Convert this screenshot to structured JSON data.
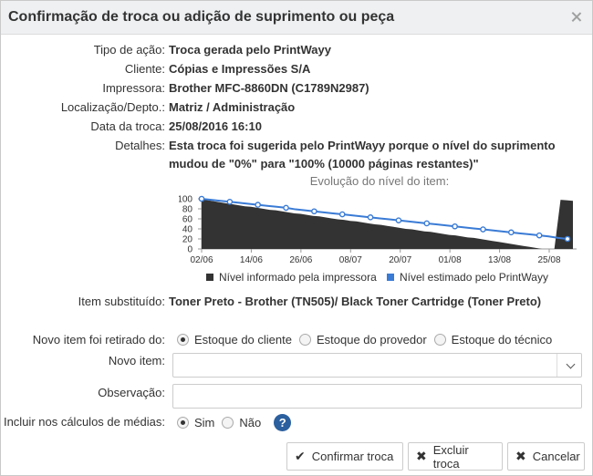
{
  "dialog": {
    "title": "Confirmação de troca ou adição de suprimento ou peça"
  },
  "details": [
    {
      "label": "Tipo de ação:",
      "value": "Troca gerada pelo PrintWayy"
    },
    {
      "label": "Cliente:",
      "value": "Cópias e Impressões S/A"
    },
    {
      "label": "Impressora:",
      "value": "Brother MFC-8860DN (C1789N2987)"
    },
    {
      "label": "Localização/Depto.:",
      "value": "Matriz / Administração"
    },
    {
      "label": "Data da troca:",
      "value": "25/08/2016 16:10"
    },
    {
      "label": "Detalhes:",
      "value": "Esta troca foi sugerida pelo PrintWayy porque o nível do suprimento mudou de \"0%\" para \"100% (10000 páginas restantes)\""
    }
  ],
  "chart_data": {
    "type": "area",
    "title": "Evolução do nível do item:",
    "xlabel": "",
    "ylabel": "",
    "x_ticks": [
      "02/06",
      "14/06",
      "26/06",
      "08/07",
      "20/07",
      "01/08",
      "13/08",
      "25/08"
    ],
    "y_ticks": [
      0,
      20,
      40,
      60,
      80,
      100
    ],
    "ylim": [
      0,
      100
    ],
    "grid": false,
    "legend_position": "bottom",
    "series": [
      {
        "name": "Nível informado pela impressora",
        "type": "area",
        "color": "#333333",
        "values": [
          99,
          97,
          95,
          93,
          91,
          89,
          87,
          85,
          84,
          82,
          80,
          78,
          77,
          75,
          73,
          71,
          70,
          68,
          66,
          65,
          63,
          61,
          59,
          58,
          56,
          55,
          53,
          51,
          49,
          48,
          46,
          44,
          42,
          40,
          39,
          37,
          35,
          34,
          32,
          30,
          28,
          27,
          25,
          23,
          22,
          20,
          18,
          16,
          14,
          12,
          10,
          8,
          6,
          4,
          2,
          0,
          0,
          0,
          98,
          97,
          96
        ]
      },
      {
        "name": "Nível estimado pelo PrintWayy",
        "type": "line",
        "color": "#3a7bd5",
        "values": [
          100,
          98,
          96,
          94,
          92,
          90,
          88,
          86,
          84,
          82,
          79,
          77,
          75,
          73,
          71,
          69,
          67,
          65,
          63,
          61,
          59,
          57,
          55,
          53,
          51,
          49,
          47,
          45,
          43,
          41,
          39,
          37,
          35,
          33,
          31,
          29,
          27,
          25,
          22,
          20
        ]
      }
    ]
  },
  "item": {
    "label": "Item substituído:",
    "value": "Toner Preto - Brother (TN505)/ Black Toner Cartridge (Toner Preto)"
  },
  "form": {
    "origin_label": "Novo item foi retirado do:",
    "origin_options": [
      {
        "label": "Estoque do cliente",
        "checked": true
      },
      {
        "label": "Estoque do provedor",
        "checked": false
      },
      {
        "label": "Estoque do técnico",
        "checked": false
      }
    ],
    "new_item_label": "Novo item:",
    "new_item_value": "",
    "note_label": "Observação:",
    "note_value": "",
    "averages_label": "Incluir nos cálculos de médias:",
    "averages_options": [
      {
        "label": "Sim",
        "checked": true
      },
      {
        "label": "Não",
        "checked": false
      }
    ],
    "help_icon": "?"
  },
  "buttons": {
    "confirm": "Confirmar troca",
    "delete": "Excluir troca",
    "cancel": "Cancelar"
  },
  "icons": {
    "close": "close-icon",
    "check": "check-icon",
    "x": "x-icon",
    "help": "help-icon",
    "chevron": "chevron-down-icon"
  }
}
